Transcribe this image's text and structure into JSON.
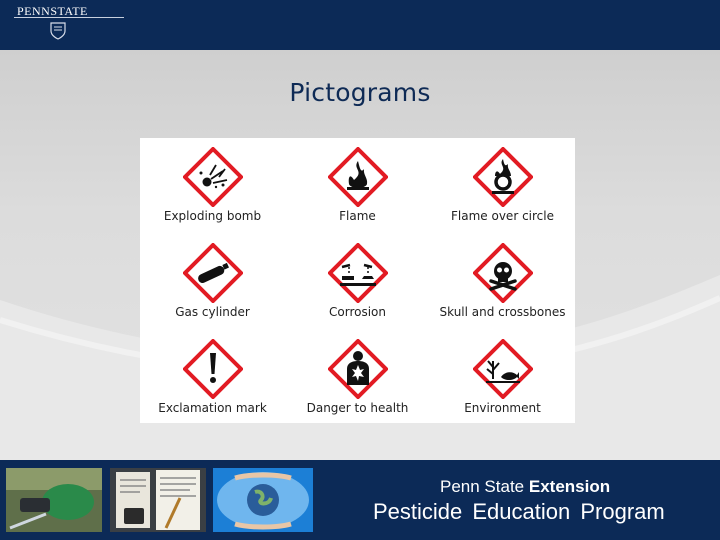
{
  "header": {
    "logo_text": "PENNSTATE",
    "logo_icon": "penn-state-shield-icon"
  },
  "slide": {
    "title": "Pictograms"
  },
  "pictograms": [
    {
      "label": "Exploding bomb",
      "icon": "exploding-bomb-icon"
    },
    {
      "label": "Flame",
      "icon": "flame-icon"
    },
    {
      "label": "Flame over circle",
      "icon": "flame-over-circle-icon"
    },
    {
      "label": "Gas cylinder",
      "icon": "gas-cylinder-icon"
    },
    {
      "label": "Corrosion",
      "icon": "corrosion-icon"
    },
    {
      "label": "Skull and crossbones",
      "icon": "skull-and-crossbones-icon"
    },
    {
      "label": "Exclamation mark",
      "icon": "exclamation-mark-icon"
    },
    {
      "label": "Danger to health",
      "icon": "health-hazard-icon"
    },
    {
      "label": "Environment",
      "icon": "environment-icon"
    }
  ],
  "footer": {
    "brand_part1": "Penn State",
    "brand_part2": "Extension",
    "program": "Pesticide Education Program"
  },
  "colors": {
    "navy": "#0c2a57",
    "pictogram_red": "#e21b23",
    "title": "#0e2a55"
  }
}
